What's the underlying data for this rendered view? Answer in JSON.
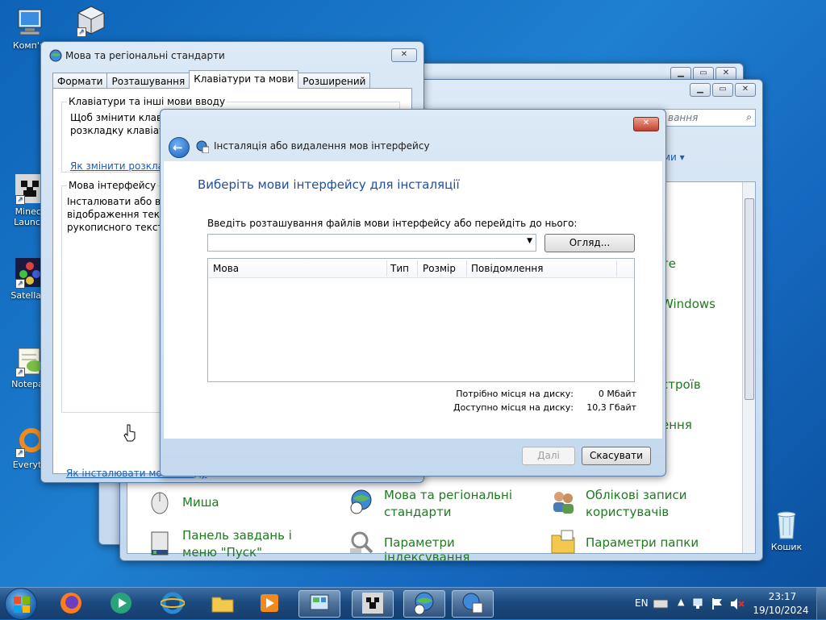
{
  "desktop": {
    "icons": [
      {
        "label": "Комп'ю"
      },
      {
        "label": ""
      },
      {
        "label": "Minecr"
      },
      {
        "label": "Launch"
      },
      {
        "label": "Satellavi"
      },
      {
        "label": "Notepac"
      },
      {
        "label": "Everyth"
      },
      {
        "label": "Кошик"
      }
    ]
  },
  "control_panel": {
    "search_placeholder": "вання",
    "view_label": "ми ▾",
    "partial_items": [
      "те",
      "Windows",
      "строїв",
      "ення"
    ],
    "items": [
      {
        "label": "Миша"
      },
      {
        "label": "Мова та регіональні стандарти"
      },
      {
        "label": "Облікові записи користувачів"
      },
      {
        "label": "Панель завдань і меню \"Пуск\""
      },
      {
        "label": "Параметри індексування"
      },
      {
        "label": "Параметри папки"
      }
    ]
  },
  "region_dialog": {
    "title": "Мова та регіональні стандарти",
    "tabs": [
      "Формати",
      "Розташування",
      "Клавіатури та мови",
      "Розширений"
    ],
    "keyboards_group": "Клавіатури та інші мови вводу",
    "keyboards_text_1": "Щоб змінити клаві",
    "keyboards_text_2": "розкладку клавіатур",
    "keyboards_link": "Як змінити розклад",
    "display_group": "Мова інтерфейсу",
    "display_text_1": "Інсталювати або ви",
    "display_text_2": "відображення текс",
    "display_text_3": "рукописного тексту",
    "bottom_link": "Як інсталювати мови вводу"
  },
  "install_dialog": {
    "nav_title": "Інсталяція або видалення мов інтерфейсу",
    "heading": "Виберіть мови інтерфейсу для інсталяції",
    "location_label": "Введіть розташування файлів мови інтерфейсу або перейдіть до нього:",
    "location_value": "",
    "browse_button": "Огляд...",
    "columns": [
      "Мова",
      "Тип",
      "Розмір",
      "Повідомлення"
    ],
    "rows": [],
    "required_label": "Потрібно місця на диску:",
    "required_value": "0 Мбайт",
    "available_label": "Доступно місця на диску:",
    "available_value": "10,3 Гбайт",
    "next_button": "Далі",
    "cancel_button": "Скасувати"
  },
  "taskbar": {
    "lang": "EN",
    "time": "23:17",
    "date": "19/10/2024"
  },
  "colors": {
    "accent": "#1a5fb4",
    "heading": "#1f4e9c",
    "cp_link_green": "#1f7a1f"
  }
}
